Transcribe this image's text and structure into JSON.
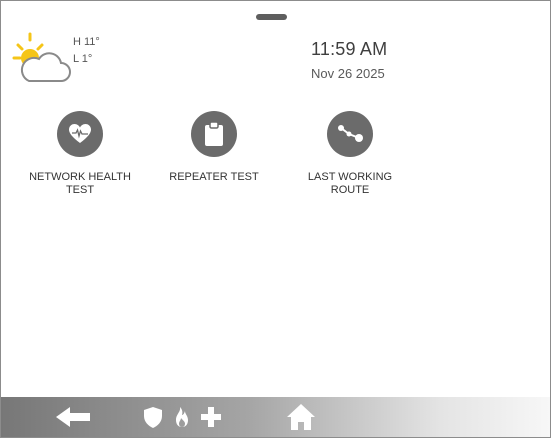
{
  "weather": {
    "icon": "partly-sunny-icon",
    "high": "H 11°",
    "low": "L 1°"
  },
  "clock": {
    "time": "11:59 AM",
    "date": "Nov 26 2025"
  },
  "tiles": [
    {
      "label": "NETWORK HEALTH\nTEST",
      "icon": "heart-monitor-icon"
    },
    {
      "label": "REPEATER TEST",
      "icon": "clipboard-icon"
    },
    {
      "label": "LAST WORKING\nROUTE",
      "icon": "route-nodes-icon"
    }
  ],
  "bottom_bar": {
    "icons": [
      "back-arrow-icon",
      "shield-icon",
      "fire-icon",
      "medical-cross-icon",
      "home-icon"
    ]
  },
  "colors": {
    "tile_circle": "#6b6b6b",
    "sun": "#f5c518",
    "cloud_outline": "#8a8a8a",
    "bar_start": "#777777",
    "bar_end": "#f7f7f7"
  }
}
